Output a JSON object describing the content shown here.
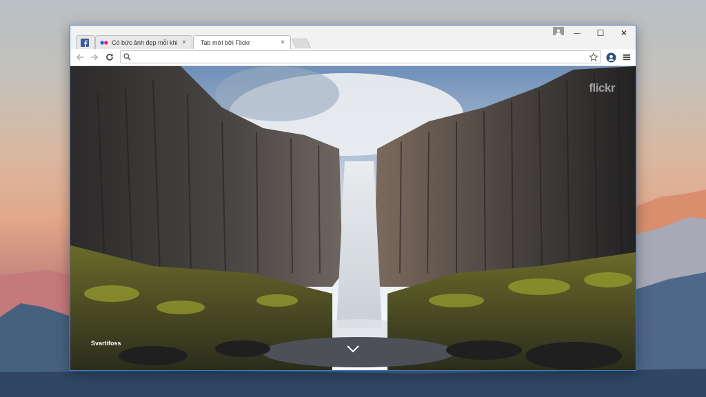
{
  "tabs": [
    {
      "label": "",
      "favicon": "facebook-icon",
      "active": false
    },
    {
      "label": "Có bức ảnh đẹp mỗi khi b",
      "favicon": "flickr-dots-icon",
      "active": false
    },
    {
      "label": "Tab mới bởi Flickr",
      "favicon": "none",
      "active": true
    }
  ],
  "tab_close_glyph": "×",
  "window_controls": {
    "minimize": "—",
    "maximize": "☐",
    "close": "✕"
  },
  "omnibox": {
    "value": "",
    "placeholder": ""
  },
  "content": {
    "photo_title": "Svartifoss",
    "brand": "flickr"
  },
  "colors": {
    "window_border": "#3d7ccf",
    "facebook_blue": "#3b5998",
    "flickr_pink": "#ff0084",
    "flickr_blue": "#0063dc"
  }
}
